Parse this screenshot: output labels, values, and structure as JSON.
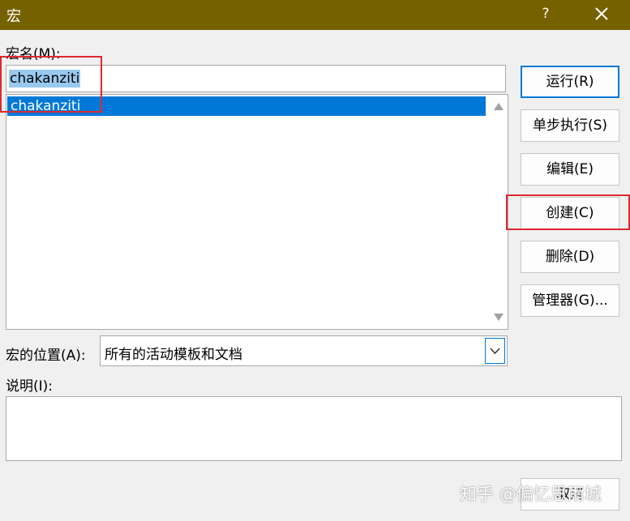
{
  "window": {
    "title": "宏",
    "help_label": "?"
  },
  "macro_name": {
    "label": "宏名(M):",
    "value": "chakanziti"
  },
  "macro_list": {
    "items": [
      "chakanziti"
    ]
  },
  "buttons": {
    "run": "运行(R)",
    "step": "单步执行(S)",
    "edit": "编辑(E)",
    "create": "创建(C)",
    "delete": "删除(D)",
    "organizer": "管理器(G)...",
    "cancel": "取消"
  },
  "location": {
    "label": "宏的位置(A):",
    "selected": "所有的活动模板和文档"
  },
  "description": {
    "label": "说明(I):",
    "value": ""
  },
  "watermark": "知乎 @偏忆思雨城",
  "colors": {
    "titlebar": "#766100",
    "selection": "#0078d7",
    "highlight_box": "#e0282f"
  },
  "icons": {
    "close": "close-icon",
    "dropdown": "chevron-down-icon",
    "scroll_up": "arrow-up-icon",
    "scroll_down": "arrow-down-icon"
  }
}
